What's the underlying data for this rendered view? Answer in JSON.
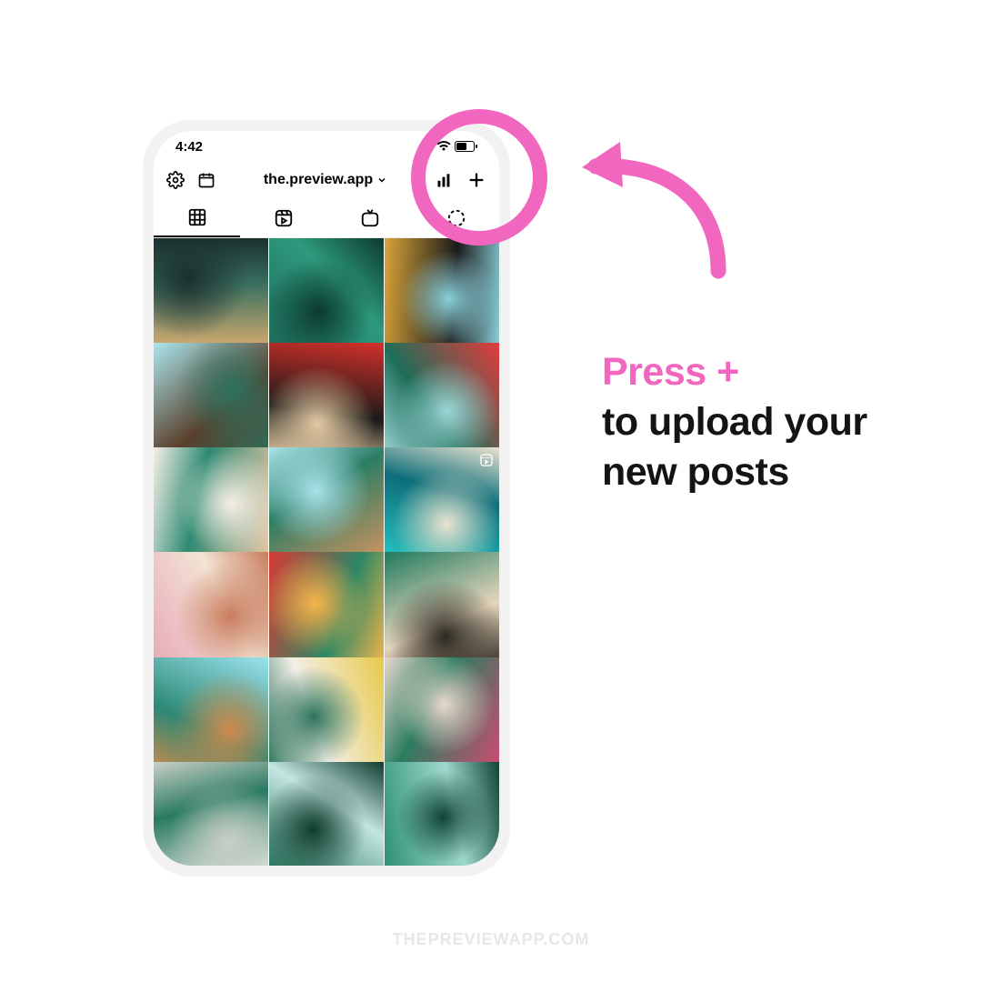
{
  "status": {
    "time": "4:42"
  },
  "header": {
    "username": "the.preview.app"
  },
  "callout": {
    "line1": "Press +",
    "line2": "to upload your new posts"
  },
  "watermark": "THEPREVIEWAPP.COM",
  "colors": {
    "accent": "#f167c0"
  },
  "grid_cells": [
    {
      "type": "photo",
      "reel": false,
      "palette": [
        "#e0b070",
        "#3a7060",
        "#1a3030"
      ]
    },
    {
      "type": "photo",
      "reel": false,
      "palette": [
        "#1d6b5a",
        "#2e9a7d",
        "#0b3a2f"
      ]
    },
    {
      "type": "photo",
      "reel": false,
      "palette": [
        "#d9a43a",
        "#1a1a1a",
        "#8ad0d9"
      ]
    },
    {
      "type": "photo",
      "reel": false,
      "palette": [
        "#a9e6ee",
        "#5a3f2a",
        "#2c715f"
      ]
    },
    {
      "type": "photo",
      "reel": false,
      "palette": [
        "#d4302a",
        "#1a1a18",
        "#e3c9a2"
      ]
    },
    {
      "type": "photo",
      "reel": false,
      "palette": [
        "#e33b3c",
        "#1f6e59",
        "#9bd6d6"
      ]
    },
    {
      "type": "photo",
      "reel": false,
      "palette": [
        "#e8c7a5",
        "#2d8a72",
        "#f5efe6"
      ]
    },
    {
      "type": "photo",
      "reel": false,
      "palette": [
        "#d7945e",
        "#2b7d65",
        "#a9e3ea"
      ]
    },
    {
      "type": "photo",
      "reel": true,
      "palette": [
        "#28c7c4",
        "#0d6e7a",
        "#e9e3cf"
      ]
    },
    {
      "type": "photo",
      "reel": false,
      "palette": [
        "#e8a9b9",
        "#f2e4d4",
        "#c97c5c"
      ]
    },
    {
      "type": "photo",
      "reel": false,
      "palette": [
        "#d83a34",
        "#2d8765",
        "#f5b54a"
      ]
    },
    {
      "type": "photo",
      "reel": false,
      "palette": [
        "#1f7a5d",
        "#e7d6bd",
        "#2e2a22"
      ]
    },
    {
      "type": "photo",
      "reel": false,
      "palette": [
        "#9be3ee",
        "#2c8874",
        "#d08a4c"
      ]
    },
    {
      "type": "photo",
      "reel": false,
      "palette": [
        "#e7c94a",
        "#f3efe7",
        "#2d745c"
      ]
    },
    {
      "type": "photo",
      "reel": false,
      "palette": [
        "#d24a72",
        "#2b7d60",
        "#e8d7cc"
      ]
    },
    {
      "type": "photo",
      "reel": false,
      "palette": [
        "#edece7",
        "#2a7a61",
        "#c9cfc6"
      ]
    },
    {
      "type": "photo",
      "reel": false,
      "palette": [
        "#1d6e55",
        "#c4e6e1",
        "#0e3b2d"
      ]
    },
    {
      "type": "photo",
      "reel": false,
      "palette": [
        "#2a8f72",
        "#9ed8cc",
        "#0f4435"
      ]
    }
  ]
}
